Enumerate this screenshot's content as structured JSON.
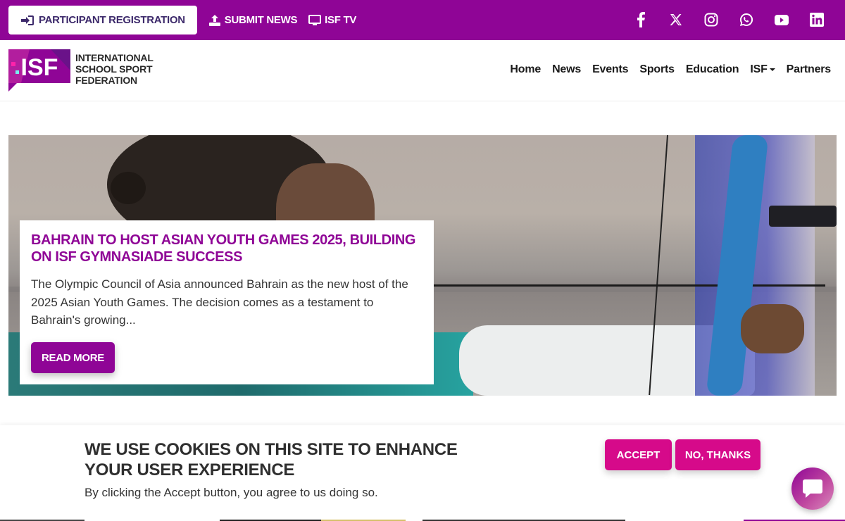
{
  "topbar": {
    "register_label": "PARTICIPANT REGISTRATION",
    "submit_news_label": "SUBMIT NEWS",
    "isf_tv_label": "ISF TV",
    "background_color": "#8f0596",
    "socials": [
      "facebook-icon",
      "x-icon",
      "instagram-icon",
      "whatsapp-icon",
      "youtube-icon",
      "linkedin-icon"
    ]
  },
  "header": {
    "logo_text_line1": "INTERNATIONAL",
    "logo_text_line2": "SCHOOL SPORT",
    "logo_text_line3": "FEDERATION",
    "logo_mark": "ISF",
    "nav": [
      "Home",
      "News",
      "Events",
      "Sports",
      "Education",
      "ISF",
      "Partners"
    ]
  },
  "hero": {
    "title": "BAHRAIN TO HOST ASIAN YOUTH GAMES 2025, BUILDING ON ISF GYMNASIADE SUCCESS",
    "excerpt": "The Olympic Council of Asia announced Bahrain as the new host of the 2025 Asian Youth Games. The decision comes as a testament to Bahrain's growing...",
    "button_label": "READ MORE",
    "accent_color": "#8f0596"
  },
  "cookie_banner": {
    "title": "WE USE COOKIES ON THIS SITE TO ENHANCE YOUR USER EXPERIENCE",
    "text": "By clicking the Accept button, you agree to us doing so.",
    "accept_label": "ACCEPT",
    "decline_label": "NO, THANKS",
    "button_color": "#d60a8a"
  },
  "chat": {
    "icon": "chat-bubble-icon"
  }
}
